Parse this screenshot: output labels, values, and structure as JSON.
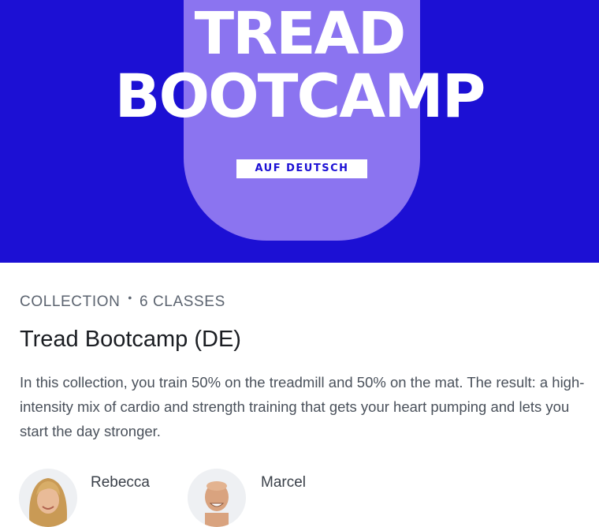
{
  "hero": {
    "title_line1": "TREAD",
    "title_line2": "BOOTCAMP",
    "badge": "AUF DEUTSCH",
    "colors": {
      "background": "#1c10d4",
      "pill": "#8b74f0"
    }
  },
  "collection": {
    "type_label": "COLLECTION",
    "separator": "•",
    "class_count": "6 CLASSES",
    "title": "Tread Bootcamp (DE)",
    "description": "In this collection, you train 50% on the treadmill and 50% on the mat. The result: a high-intensity mix of cardio and strength training that gets your heart pumping and lets you start the day stronger."
  },
  "instructors": [
    {
      "name": "Rebecca",
      "avatar": "instructor-avatar"
    },
    {
      "name": "Marcel",
      "avatar": "instructor-avatar"
    }
  ]
}
